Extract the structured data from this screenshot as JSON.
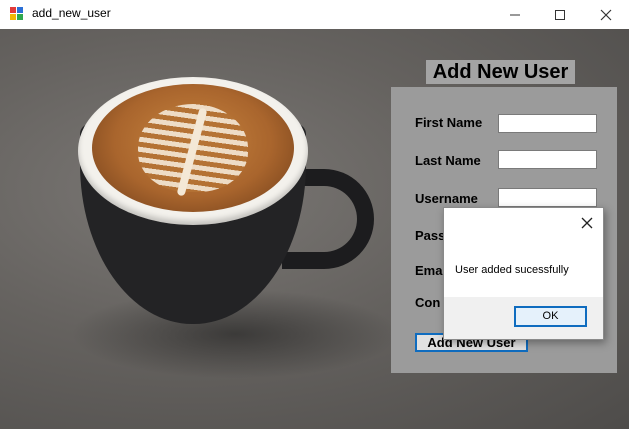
{
  "window": {
    "title": "add_new_user",
    "icon": "winforms-app-icon",
    "controls": {
      "minimize": "minimize-icon",
      "maximize": "maximize-icon",
      "close": "close-icon"
    }
  },
  "form": {
    "title": "Add New User",
    "fields": [
      {
        "label": "First Name",
        "value": ""
      },
      {
        "label": "Last Name",
        "value": ""
      },
      {
        "label": "Username",
        "value": ""
      },
      {
        "label": "Pass",
        "value": ""
      },
      {
        "label": "Ema",
        "value": ""
      },
      {
        "label": "Con",
        "value": ""
      }
    ],
    "submit_label": "Add New User"
  },
  "dialog": {
    "message": "User added sucessfully",
    "ok_label": "OK"
  },
  "colors": {
    "accent": "#0f6cbf",
    "panel": "#9b9b9b",
    "title_bg": "#a4a4a4"
  }
}
